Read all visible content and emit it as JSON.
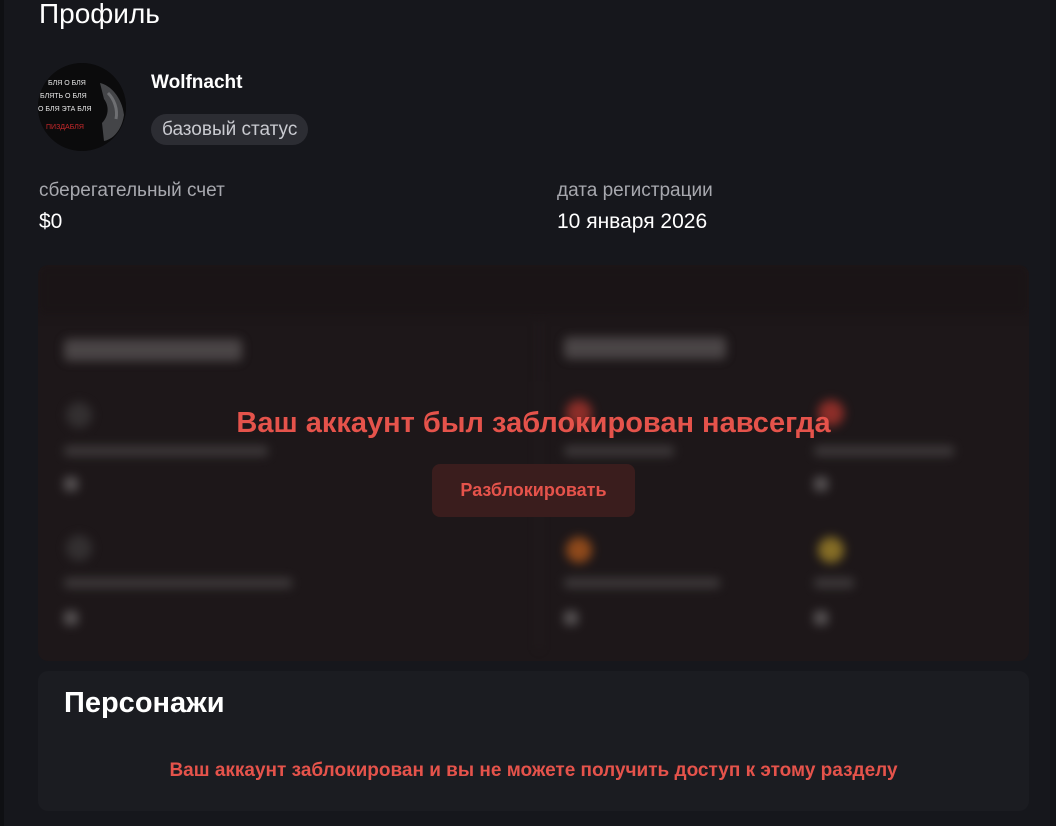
{
  "profile": {
    "title": "Профиль",
    "username": "Wolfnacht",
    "status": "базовый статус",
    "avatar_text": [
      "БЛЯ О БЛЯ",
      "БЛЯТЬ О БЛЯ",
      "О БЛЯ ЭТА БЛЯ",
      "ПИЗДАБЛЯ"
    ]
  },
  "stats": {
    "savings_label": "сберегательный счет",
    "savings_value": "$0",
    "registration_label": "дата регистрации",
    "registration_value": "10 января 2026"
  },
  "blocked": {
    "message": "Ваш аккаунт был заблокирован навсегда",
    "unblock_label": "Разблокировать"
  },
  "characters": {
    "title": "Персонажи",
    "message": "Ваш аккаунт заблокирован и вы не можете получить доступ к этому разделу"
  },
  "colors": {
    "background": "#16171c",
    "error": "#e5534b",
    "panel": "#1b1c21",
    "blocked_panel": "#1d1719"
  }
}
